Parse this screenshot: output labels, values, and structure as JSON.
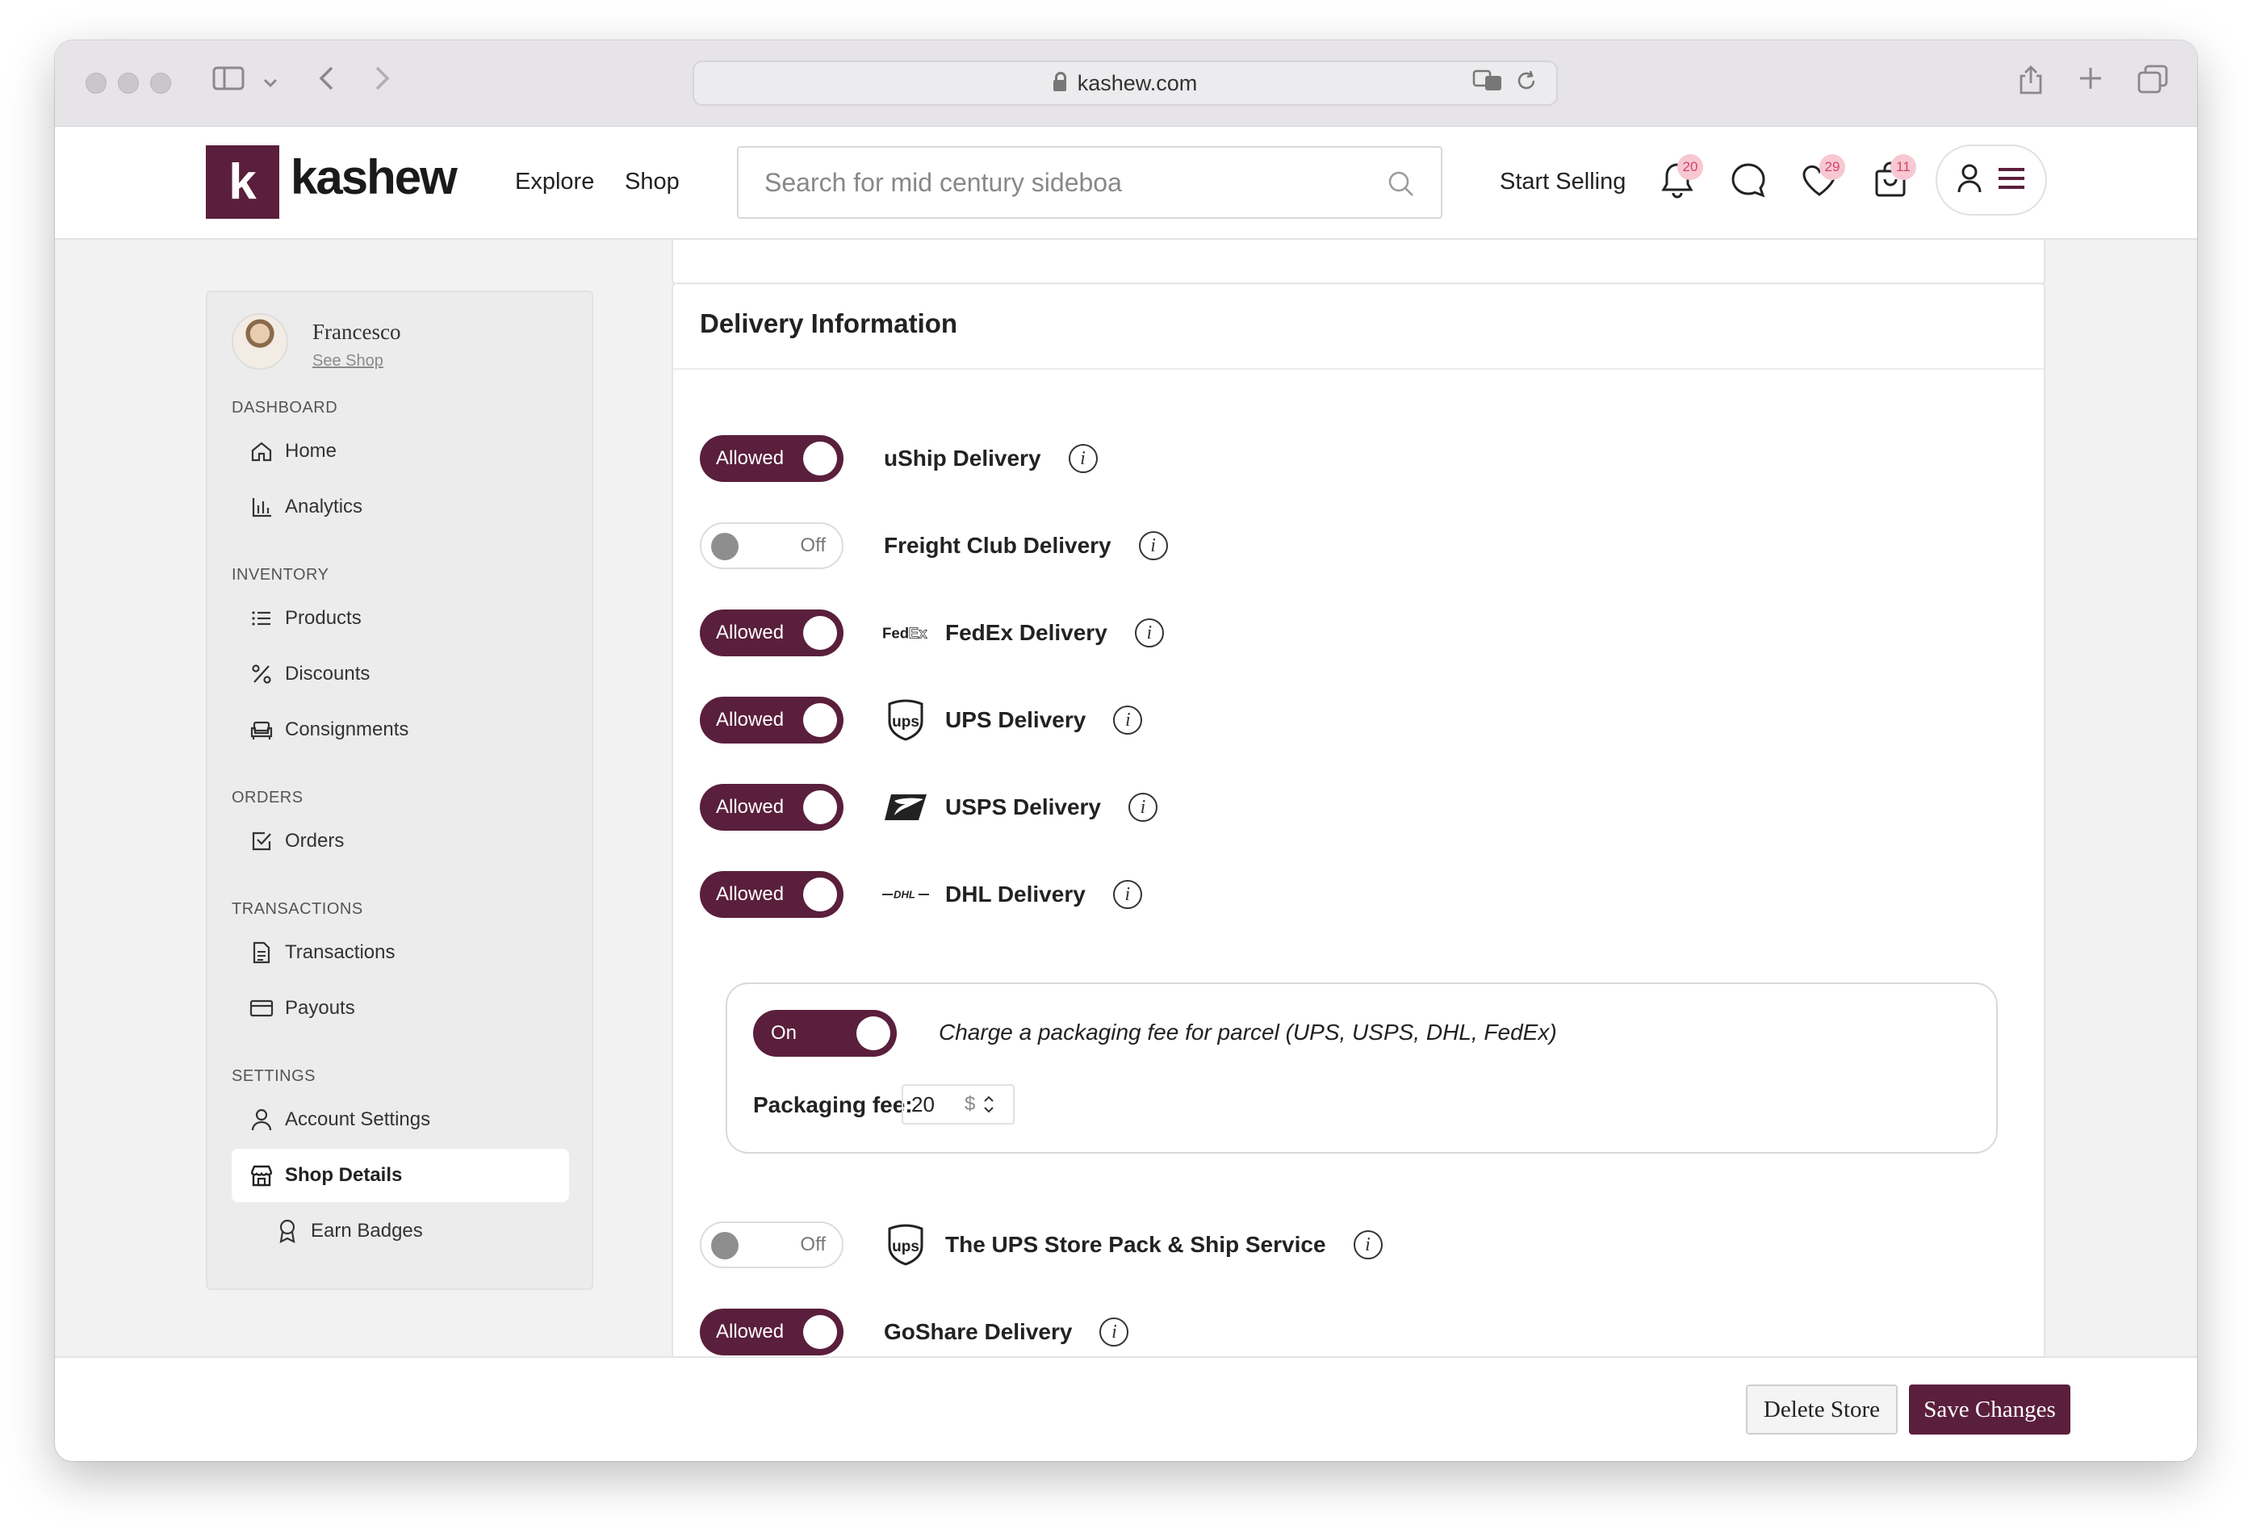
{
  "browser": {
    "url": "kashew.com"
  },
  "header": {
    "logo_letter": "k",
    "logo_text": "kashew",
    "nav": [
      "Explore",
      "Shop"
    ],
    "search_placeholder": "Search for mid century sideboa",
    "start_selling": "Start Selling",
    "notifications_count": "20",
    "favorites_count": "29",
    "cart_count": "11"
  },
  "sidebar": {
    "profile_name": "Francesco",
    "profile_link": "See Shop",
    "sections": [
      {
        "title": "DASHBOARD",
        "items": [
          "Home",
          "Analytics"
        ]
      },
      {
        "title": "INVENTORY",
        "items": [
          "Products",
          "Discounts",
          "Consignments"
        ]
      },
      {
        "title": "ORDERS",
        "items": [
          "Orders"
        ]
      },
      {
        "title": "TRANSACTIONS",
        "items": [
          "Transactions",
          "Payouts"
        ]
      },
      {
        "title": "SETTINGS",
        "items": [
          "Account Settings",
          "Shop Details",
          "Earn Badges"
        ]
      }
    ],
    "active_item": "Shop Details"
  },
  "main": {
    "title": "Delivery Information",
    "deliveries": [
      {
        "label": "uShip Delivery",
        "state": "Allowed",
        "logo": ""
      },
      {
        "label": "Freight Club Delivery",
        "state": "Off",
        "logo": ""
      },
      {
        "label": "FedEx Delivery",
        "state": "Allowed",
        "logo": "fedex-logo"
      },
      {
        "label": "UPS Delivery",
        "state": "Allowed",
        "logo": "ups-logo"
      },
      {
        "label": "USPS Delivery",
        "state": "Allowed",
        "logo": "usps-logo"
      },
      {
        "label": "DHL Delivery",
        "state": "Allowed",
        "logo": "dhl-logo"
      }
    ],
    "packaging": {
      "toggle": "On",
      "text": "Charge a packaging fee for parcel (UPS, USPS, DHL, FedEx)",
      "fee_label": "Packaging fee:",
      "fee_value": "20",
      "currency": "$"
    },
    "deliveries_after": [
      {
        "label": "The UPS Store Pack & Ship Service",
        "state": "Off",
        "logo": "ups-logo"
      },
      {
        "label": "GoShare Delivery",
        "state": "Allowed",
        "logo": ""
      }
    ]
  },
  "footer": {
    "delete_label": "Delete Store",
    "save_label": "Save Changes"
  },
  "colors": {
    "brand": "#5a1f3c",
    "badge_bg": "#f7c8d2",
    "badge_text": "#d0436a"
  }
}
